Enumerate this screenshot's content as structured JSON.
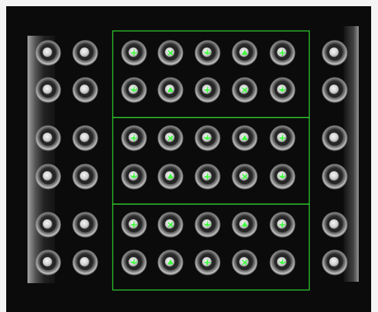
{
  "image": {
    "description_hidden": "",
    "colors": {
      "page": "#f4f4f4",
      "frame": "#0b0b0b",
      "roi_green": "#2fd52f",
      "marker_green": "#3dff3d"
    }
  },
  "roi_boxes": [
    {
      "id": "roi-top",
      "label": ""
    },
    {
      "id": "roi-middle",
      "label": ""
    },
    {
      "id": "roi-bottom",
      "label": ""
    }
  ],
  "grid": {
    "left_columns": 2,
    "inspected_columns": 5,
    "right_columns": 1,
    "rows": 6
  }
}
